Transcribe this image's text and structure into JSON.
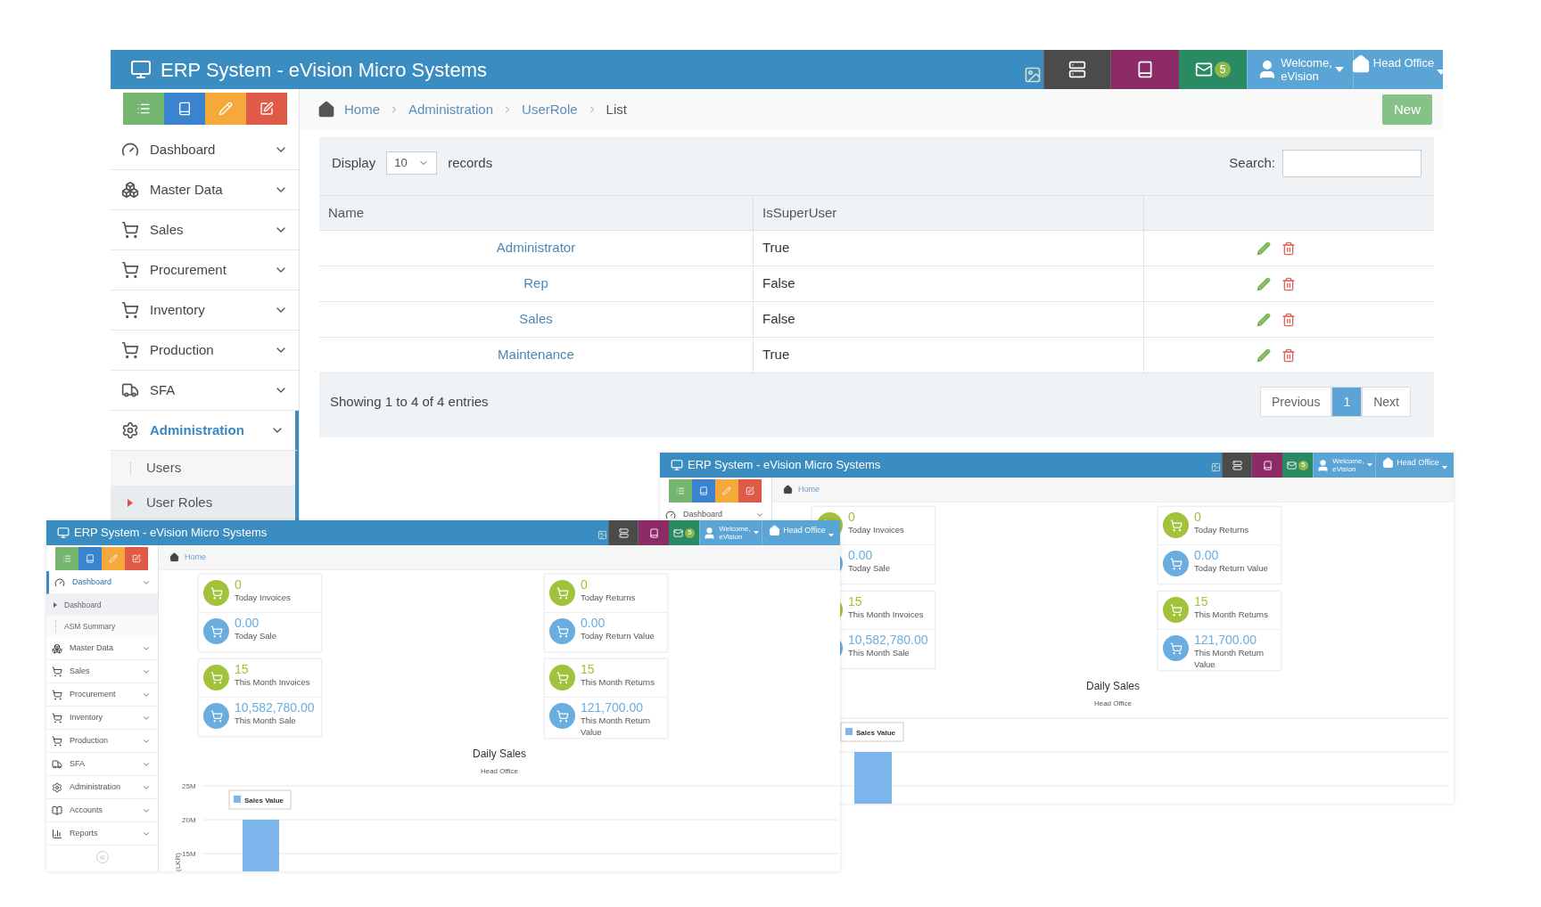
{
  "main_window": {
    "title": "ERP System - eVision Micro Systems",
    "mail_count": "5",
    "welcome": "Welcome,",
    "user": "eVision",
    "branch": "Head Office",
    "sidebar": [
      {
        "label": "Dashboard",
        "selected": false
      },
      {
        "label": "Master Data",
        "selected": false
      },
      {
        "label": "Sales",
        "selected": false
      },
      {
        "label": "Procurement",
        "selected": false
      },
      {
        "label": "Inventory",
        "selected": false
      },
      {
        "label": "Production",
        "selected": false
      },
      {
        "label": "SFA",
        "selected": false
      },
      {
        "label": "Administration",
        "selected": true,
        "children": [
          {
            "label": "Users",
            "selected": false
          },
          {
            "label": "User Roles",
            "selected": true
          }
        ]
      }
    ],
    "breadcrumb": [
      "Home",
      "Administration",
      "UserRole",
      "List"
    ],
    "new_button": "New",
    "display_label": "Display",
    "page_size": "10",
    "records_label": "records",
    "search_label": "Search:",
    "table": {
      "columns": [
        "Name",
        "IsSuperUser"
      ],
      "rows": [
        {
          "name": "Administrator",
          "is_super_user": "True"
        },
        {
          "name": "Rep",
          "is_super_user": "False"
        },
        {
          "name": "Sales",
          "is_super_user": "False"
        },
        {
          "name": "Maintenance",
          "is_super_user": "True"
        }
      ]
    },
    "summary": "Showing 1 to 4 of 4 entries",
    "pagination": [
      {
        "label": "Previous",
        "selected": false
      },
      {
        "label": "1",
        "selected": true
      },
      {
        "label": "Next",
        "selected": false
      }
    ]
  },
  "right_window": {
    "title": "ERP System - eVision Micro Systems",
    "mail_count": "5",
    "welcome": "Welcome,",
    "user": "eVision",
    "branch": "Head Office",
    "sidebar": [
      {
        "label": "Dashboard",
        "selected": false
      }
    ],
    "breadcrumb": [
      "Home"
    ],
    "tile_columns": [
      [
        [
          {
            "value": "0",
            "label": "Today Invoices",
            "color": "#a2c23c"
          },
          {
            "value": "0.00",
            "label": "Today Sale",
            "color": "#6aaddf"
          }
        ],
        [
          {
            "value": "15",
            "label": "This Month Invoices",
            "color": "#a2c23c"
          },
          {
            "value": "10,582,780.00",
            "label": "This Month Sale",
            "color": "#6aaddf"
          }
        ]
      ],
      [
        [
          {
            "value": "0",
            "label": "Today Returns",
            "color": "#a2c23c"
          },
          {
            "value": "0.00",
            "label": "Today Return Value",
            "color": "#6aaddf"
          }
        ],
        [
          {
            "value": "15",
            "label": "This Month Returns",
            "color": "#a2c23c"
          },
          {
            "value": "121,700.00",
            "label": "This Month Return Value",
            "color": "#6aaddf"
          }
        ]
      ]
    ],
    "chart_title": "Daily Sales",
    "chart_subtitle": "Head Office",
    "legend": "Sales Value"
  },
  "left_window": {
    "title": "ERP System - eVision Micro Systems",
    "mail_count": "5",
    "welcome": "Welcome,",
    "user": "eVision",
    "branch": "Head Office",
    "sidebar": [
      {
        "label": "Dashboard",
        "selected": true,
        "children": [
          {
            "label": "Dashboard",
            "selected": true
          },
          {
            "label": "ASM Summary",
            "selected": false
          }
        ]
      },
      {
        "label": "Master Data",
        "selected": false
      },
      {
        "label": "Sales",
        "selected": false
      },
      {
        "label": "Procurement",
        "selected": false
      },
      {
        "label": "Inventory",
        "selected": false
      },
      {
        "label": "Production",
        "selected": false
      },
      {
        "label": "SFA",
        "selected": false
      },
      {
        "label": "Administration",
        "selected": false
      },
      {
        "label": "Accounts",
        "selected": false
      },
      {
        "label": "Reports",
        "selected": false
      }
    ],
    "breadcrumb": [
      "Home"
    ],
    "tile_columns": [
      [
        [
          {
            "value": "0",
            "label": "Today Invoices",
            "color": "#a2c23c"
          },
          {
            "value": "0.00",
            "label": "Today Sale",
            "color": "#6aaddf"
          }
        ],
        [
          {
            "value": "15",
            "label": "This Month Invoices",
            "color": "#a2c23c"
          },
          {
            "value": "10,582,780.00",
            "label": "This Month Sale",
            "color": "#6aaddf"
          }
        ]
      ],
      [
        [
          {
            "value": "0",
            "label": "Today Returns",
            "color": "#a2c23c"
          },
          {
            "value": "0.00",
            "label": "Today Return Value",
            "color": "#6aaddf"
          }
        ],
        [
          {
            "value": "15",
            "label": "This Month Returns",
            "color": "#a2c23c"
          },
          {
            "value": "121,700.00",
            "label": "This Month Return Value",
            "color": "#6aaddf"
          }
        ]
      ]
    ],
    "chart_title": "Daily Sales",
    "chart_subtitle": "Head Office",
    "y_label": "(LKR)",
    "y_ticks": [
      "25M",
      "20M",
      "15M"
    ],
    "legend": "Sales Value"
  }
}
